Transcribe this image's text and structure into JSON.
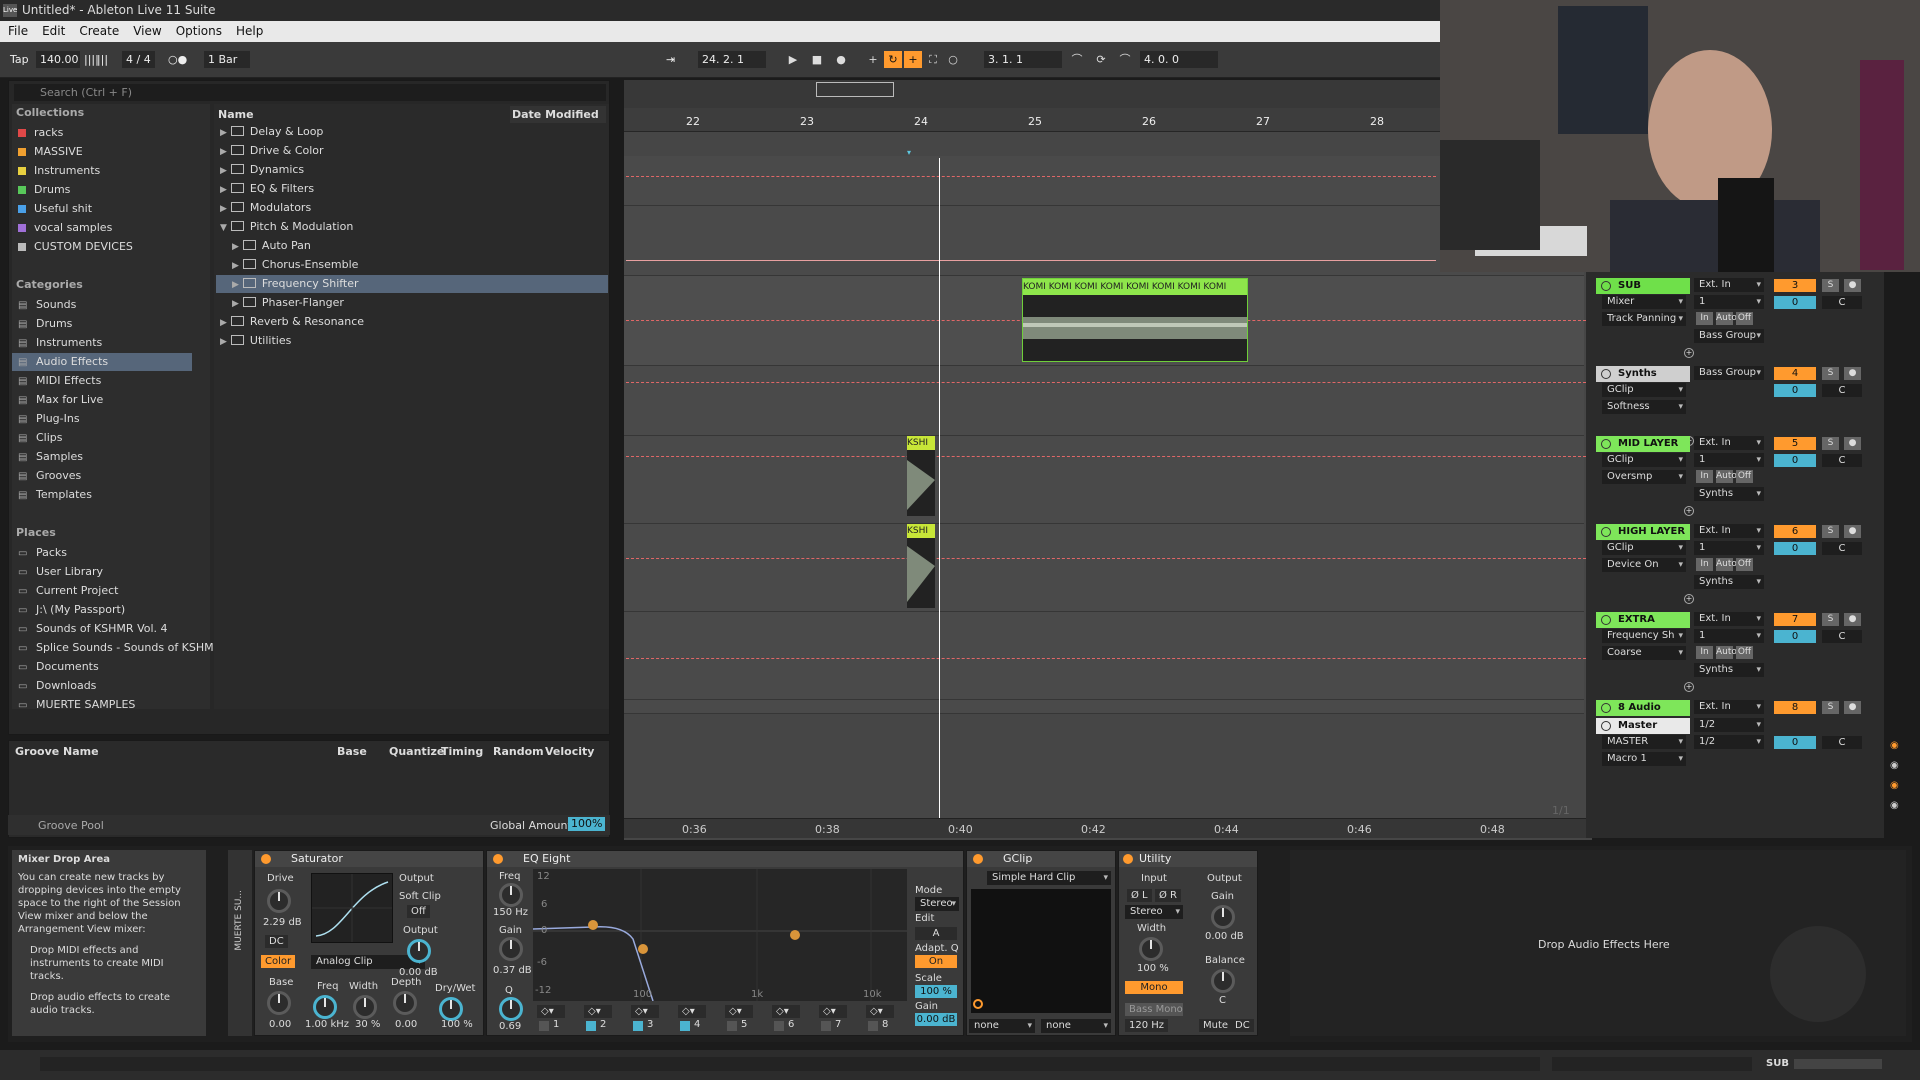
{
  "window": {
    "title": "Untitled* - Ableton Live 11 Suite",
    "logo": "Live"
  },
  "menu": [
    "File",
    "Edit",
    "Create",
    "View",
    "Options",
    "Help"
  ],
  "transport": {
    "tap": "Tap",
    "tempo": "140.00",
    "signature": "4 / 4",
    "quantize": "1 Bar",
    "arr_position": "24.   2.   1",
    "loop_start": "3.   1.   1",
    "loop_length": "4.   0.   0",
    "metronome": "○●"
  },
  "browser": {
    "search_placeholder": "Search (Ctrl + F)",
    "collections_title": "Collections",
    "collections": [
      {
        "label": "racks",
        "color": "#e04848"
      },
      {
        "label": "MASSIVE",
        "color": "#f0a030"
      },
      {
        "label": "Instruments",
        "color": "#e8d040"
      },
      {
        "label": "Drums",
        "color": "#58c85a"
      },
      {
        "label": "Useful shit",
        "color": "#4aa0e8"
      },
      {
        "label": "vocal samples",
        "color": "#a070d8"
      },
      {
        "label": "CUSTOM DEVICES",
        "color": "#bbbbbb"
      }
    ],
    "categories_title": "Categories",
    "categories": [
      {
        "label": "Sounds",
        "icon": "note-icon"
      },
      {
        "label": "Drums",
        "icon": "grid-icon"
      },
      {
        "label": "Instruments",
        "icon": "clock-icon"
      },
      {
        "label": "Audio Effects",
        "icon": "eq-icon",
        "selected": true
      },
      {
        "label": "MIDI Effects",
        "icon": "midi-icon"
      },
      {
        "label": "Max for Live",
        "icon": "m4l-icon"
      },
      {
        "label": "Plug-Ins",
        "icon": "plug-icon"
      },
      {
        "label": "Clips",
        "icon": "clip-icon"
      },
      {
        "label": "Samples",
        "icon": "wave-icon"
      },
      {
        "label": "Grooves",
        "icon": "groove-icon"
      },
      {
        "label": "Templates",
        "icon": "template-icon"
      }
    ],
    "places_title": "Places",
    "places": [
      "Packs",
      "User Library",
      "Current Project",
      "J:\\ (My Passport)",
      "Sounds of KSHMR Vol. 4",
      "Splice Sounds - Sounds of KSHMR",
      "Documents",
      "Downloads",
      "MUERTE SAMPLES"
    ],
    "col_name": "Name",
    "col_date": "Date Modified",
    "files": [
      {
        "label": "Delay & Loop",
        "indent": 0
      },
      {
        "label": "Drive & Color",
        "indent": 0
      },
      {
        "label": "Dynamics",
        "indent": 0
      },
      {
        "label": "EQ & Filters",
        "indent": 0
      },
      {
        "label": "Modulators",
        "indent": 0
      },
      {
        "label": "Pitch & Modulation",
        "indent": 0,
        "open": true
      },
      {
        "label": "Auto Pan",
        "indent": 1
      },
      {
        "label": "Chorus-Ensemble",
        "indent": 1
      },
      {
        "label": "Frequency Shifter",
        "indent": 1,
        "selected": true
      },
      {
        "label": "Phaser-Flanger",
        "indent": 1
      },
      {
        "label": "Reverb & Resonance",
        "indent": 0
      },
      {
        "label": "Utilities",
        "indent": 0
      }
    ]
  },
  "groove": {
    "headers": [
      "Groove Name",
      "Base",
      "Quantize",
      "Timing",
      "Random",
      "Velocity"
    ],
    "pool": "Groove Pool",
    "global_label": "Global Amount",
    "global_value": "100%"
  },
  "arrangement": {
    "bars": [
      "22",
      "23",
      "24",
      "25",
      "26",
      "27",
      "28"
    ],
    "times": [
      "0:36",
      "0:38",
      "0:40",
      "0:42",
      "0:44",
      "0:46",
      "0:48"
    ],
    "clip_main": "KOMI KOMI KOMI KOMI KOMI KOMI KOMI KOMI",
    "clip_small1": "KSHI",
    "clip_small2": "KSHI",
    "zoom": "1/1"
  },
  "tracks": [
    {
      "name": "SUB",
      "color": "#6fe04a",
      "in": "Ext. In",
      "ch": "1",
      "num": "3",
      "dev": "Mixer",
      "param": "Track Panning",
      "out": "Bass Group",
      "vol": "0",
      "pan": "C",
      "monitor": [
        "In",
        "Auto",
        "Off"
      ]
    },
    {
      "name": "Synths",
      "color": "#cfcfcf",
      "in": "Bass Group",
      "ch": "",
      "num": "4",
      "dev": "GClip",
      "param": "Softness",
      "out": "",
      "vol": "0",
      "pan": "C",
      "monitor": []
    },
    {
      "name": "MID LAYER",
      "color": "#7ee65a",
      "in": "Ext. In",
      "ch": "1",
      "num": "5",
      "dev": "GClip",
      "param": "Oversmp",
      "out": "Synths",
      "vol": "0",
      "pan": "C",
      "monitor": [
        "In",
        "Auto",
        "Off"
      ]
    },
    {
      "name": "HIGH LAYER",
      "color": "#7ee65a",
      "in": "Ext. In",
      "ch": "1",
      "num": "6",
      "dev": "GClip",
      "param": "Device On",
      "out": "Synths",
      "vol": "0",
      "pan": "C",
      "monitor": [
        "In",
        "Auto",
        "Off"
      ]
    },
    {
      "name": "EXTRA",
      "color": "#7ee65a",
      "in": "Ext. In",
      "ch": "1",
      "num": "7",
      "dev": "Frequency Sh",
      "param": "Coarse",
      "out": "Synths",
      "vol": "0",
      "pan": "C",
      "monitor": [
        "In",
        "Auto",
        "Off"
      ]
    },
    {
      "name": "8 Audio",
      "color": "#7ee65a",
      "in": "Ext. In",
      "num": "8"
    },
    {
      "name": "Master",
      "color": "#e9e9e9",
      "in": "1/2",
      "ch": "1/2",
      "dev": "MASTER",
      "param": "Macro 1",
      "vol": "0",
      "pan": "C"
    }
  ],
  "devices": {
    "info_title": "Mixer Drop Area",
    "info_body": "You can create new tracks by dropping devices into the empty space to the right of the Session View mixer and below the Arrangement View mixer:",
    "info_bullets": [
      "Drop MIDI effects and instruments to create MIDI tracks.",
      "Drop audio effects to create audio tracks."
    ],
    "chain_label": "MUERTE SU...",
    "saturator": {
      "title": "Saturator",
      "drive_label": "Drive",
      "drive_value": "2.29 dB",
      "dc": "DC",
      "color": "Color",
      "mode": "Analog Clip",
      "output_label": "Output",
      "softclip_label": "Soft Clip",
      "softclip_value": "Off",
      "output_knob_label": "Output",
      "output_value": "0.00 dB",
      "base": "Base",
      "base_value": "0.00",
      "freq": "Freq",
      "freq_value": "1.00 kHz",
      "width": "Width",
      "width_value": "30 %",
      "depth": "Depth",
      "depth_value": "0.00",
      "drywet": "Dry/Wet",
      "drywet_value": "100 %"
    },
    "eq": {
      "title": "EQ Eight",
      "freq_label": "Freq",
      "freq_value": "150 Hz",
      "gain_label": "Gain",
      "gain_value": "0.37 dB",
      "q_label": "Q",
      "q_value": "0.69",
      "mode_label": "Mode",
      "mode_value": "Stereo",
      "edit": "Edit",
      "edit_value": "A",
      "adaptq": "Adapt. Q",
      "adaptq_value": "On",
      "scale": "Scale",
      "scale_value": "100 %",
      "gain2": "Gain",
      "gain2_value": "0.00 dB",
      "grid_labels": [
        "12",
        "6",
        "0",
        "-6",
        "-12"
      ],
      "freq_ticks": [
        "100",
        "1k",
        "10k"
      ],
      "bands": [
        "1",
        "2",
        "3",
        "4",
        "5",
        "6",
        "7",
        "8"
      ]
    },
    "gclip": {
      "title": "GClip",
      "plugin": "Simple Hard Clip",
      "sel1": "none",
      "sel2": "none"
    },
    "utility": {
      "title": "Utility",
      "input": "Input",
      "output": "Output",
      "phase_l": "Ø L",
      "phase_r": "Ø R",
      "stereo": "Stereo",
      "width": "Width",
      "width_value": "100 %",
      "mono": "Mono",
      "bassmono": "Bass Mono",
      "freq": "120 Hz",
      "gain": "Gain",
      "gain_value": "0.00 dB",
      "balance": "Balance",
      "balance_value": "C",
      "mute": "Mute",
      "dc": "DC"
    },
    "drop_label": "Drop Audio Effects Here"
  },
  "status": {
    "track": "SUB"
  }
}
